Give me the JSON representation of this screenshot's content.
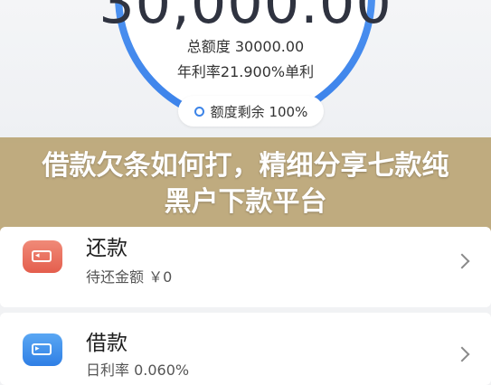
{
  "credit": {
    "amount_display": "30,000.00",
    "total_label": "总额度 30000.00",
    "rate_label": "年利率21.900%单利",
    "remaining_label": "额度剩余 100%",
    "remaining_fraction": 1.0,
    "ring_color": "#4a8ff0"
  },
  "banner": {
    "text": "借款欠条如何打，精细分享七款纯黑户下款平台",
    "color": "#b8a06d"
  },
  "cards": {
    "repay": {
      "title": "还款",
      "subtitle": "待还金额 ￥0",
      "icon": "repay-card-icon"
    },
    "borrow": {
      "title": "借款",
      "subtitle": "日利率 0.060%",
      "icon": "borrow-card-icon"
    }
  }
}
